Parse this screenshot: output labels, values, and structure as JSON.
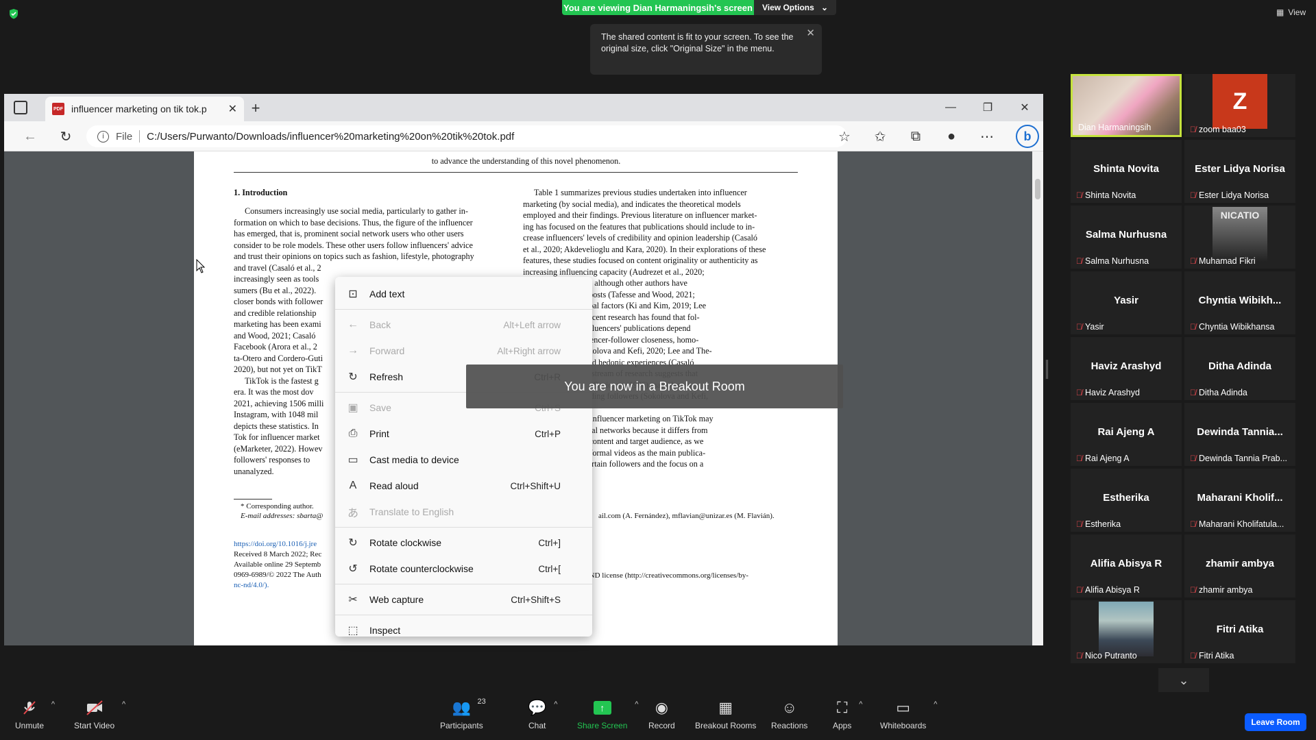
{
  "zoom_banner": {
    "viewing": "You are viewing Dian Harmaningsih's screen",
    "view_options": "View Options"
  },
  "tooltip": "The shared content is fit to your screen. To see the original size, click \"Original Size\" in the menu.",
  "top_right_view": "View",
  "browser": {
    "tab_title": "influencer marketing on tik tok.p",
    "address_prefix": "File",
    "url": "C:/Users/Purwanto/Downloads/influencer%20marketing%20on%20tik%20tok.pdf"
  },
  "pdf": {
    "header_line": "to advance the understanding of this novel phenomenon.",
    "intro_heading": "1.  Introduction",
    "left_col": [
      "Consumers increasingly use social media, particularly to gather in-",
      "formation on which to base decisions. Thus, the figure of the influencer",
      "has emerged, that is, prominent social network users who other users",
      "consider to be role models. These other users follow influencers' advice",
      "and trust their opinions on topics such as fashion, lifestyle, photography",
      "and travel (Casaló et al., 2",
      "increasingly seen as tools",
      "sumers (Bu et al., 2022).",
      "closer bonds with follower",
      "and credible relationship",
      "marketing has been exami",
      "and Wood, 2021; Casaló",
      "Facebook (Arora et al., 2",
      "ta-Otero and Cordero-Guti",
      "2020), but not yet on TikT",
      "TikTok is the fastest g",
      "era. It was the most dov",
      "2021, achieving 1506 milli",
      "Instagram, with 1048 mil",
      "depicts these statistics. In",
      "Tok for influencer market",
      "(eMarketer, 2022). Howev",
      "followers' responses to",
      "unanalyzed."
    ],
    "right_col": [
      "Table 1 summarizes previous studies undertaken into influencer",
      "marketing (by social media), and indicates the theoretical models",
      "employed and their findings. Previous literature on influencer market-",
      "ing has focused on the features that publications should include to in-",
      "crease influencers' levels of credibility and opinion leadership (Casaló",
      "et al., 2020; Akdevelioglu and Kara, 2020). In their explorations of these",
      "features, these studies focused on content originality or authenticity as",
      "increasing influencing capacity (Audrezet et al., 2020;",
      "20; Lee et al., 2022), although other authors have",
      "ntity and quality of posts (Tafesse and Wood, 2021;",
      ") and visual and verbal factors (Ki and Kim, 2019; Lee",
      "21). Nevertheless, recent research has found that fol-",
      "responses toward influencers' publications depend",
      "factors such as influencer-follower closeness, homo-",
      "ional contagion (Sokolova and Kefi, 2020; Lee and The-",
      "positive emotions and hedonic experiences (Casaló",
      "and Ha, 2021). This stream of research suggests that",
      "... (ELM) (Petty and Cacioppo, 1986) may play an",
      "ortant role in persuading followers (Sokolova and Kefi,",
      "eokary, 2021).",
      "ers' responses to influencer marketing on TikTok may",
      "s made on other social networks because it differs from",
      "publication format, content and target audience, as we",
      ". The use of short informal videos as the main publica-",
      "use of humor to entertain followers and the focus on a"
    ],
    "footnote": [
      "* Corresponding author.",
      "E-mail addresses: sbarta@",
      "ail.com (A. Fernández), mflavian@unizar.es (M. Flavián)."
    ],
    "footer": [
      "https://doi.org/10.1016/j.jre",
      "Received 8 March 2022; Rec",
      "Available online 29 Septemb",
      "0969-6989/© 2022 The Auth",
      "BY-NC-ND license (http://creativecommons.org/licenses/by-",
      "nc-nd/4.0/)."
    ]
  },
  "context_menu": [
    {
      "label": "Add text",
      "shortcut": "",
      "icon": "add-text-icon",
      "enabled": true
    },
    {
      "label": "Back",
      "shortcut": "Alt+Left arrow",
      "icon": "back-arrow-icon",
      "enabled": false
    },
    {
      "label": "Forward",
      "shortcut": "Alt+Right arrow",
      "icon": "forward-arrow-icon",
      "enabled": false
    },
    {
      "label": "Refresh",
      "shortcut": "Ctrl+R",
      "icon": "refresh-icon",
      "enabled": true
    },
    {
      "label": "Save",
      "shortcut": "Ctrl+S",
      "icon": "save-icon",
      "enabled": false
    },
    {
      "label": "Print",
      "shortcut": "Ctrl+P",
      "icon": "print-icon",
      "enabled": true
    },
    {
      "label": "Cast media to device",
      "shortcut": "",
      "icon": "cast-icon",
      "enabled": true
    },
    {
      "label": "Read aloud",
      "shortcut": "Ctrl+Shift+U",
      "icon": "read-aloud-icon",
      "enabled": true
    },
    {
      "label": "Translate to English",
      "shortcut": "",
      "icon": "translate-icon",
      "enabled": false
    },
    {
      "label": "Rotate clockwise",
      "shortcut": "Ctrl+]",
      "icon": "rotate-clockwise-icon",
      "enabled": true
    },
    {
      "label": "Rotate counterclockwise",
      "shortcut": "Ctrl+[",
      "icon": "rotate-counterclockwise-icon",
      "enabled": true
    },
    {
      "label": "Web capture",
      "shortcut": "Ctrl+Shift+S",
      "icon": "web-capture-icon",
      "enabled": true
    },
    {
      "label": "Inspect",
      "shortcut": "",
      "icon": "inspect-icon",
      "enabled": true
    }
  ],
  "breakout_notice": "You are now in a Breakout Room",
  "participants": [
    {
      "name": "Dian Harmaningsih",
      "big": ""
    },
    {
      "name": "zoom baa03",
      "big": "Z"
    },
    {
      "name": "Shinta Novita",
      "big": "Shinta Novita"
    },
    {
      "name": "Ester Lidya Norisa",
      "big": "Ester Lidya Norisa"
    },
    {
      "name": "Salma Nurhusna",
      "big": "Salma Nurhusna"
    },
    {
      "name": "Muhamad Fikri",
      "big": "NICATIO"
    },
    {
      "name": "Yasir",
      "big": "Yasir"
    },
    {
      "name": "Chyntia Wibikhansa",
      "big": "Chyntia  Wibikh..."
    },
    {
      "name": "Haviz Arashyd",
      "big": "Haviz Arashyd"
    },
    {
      "name": "Ditha Adinda",
      "big": "Ditha Adinda"
    },
    {
      "name": "Rai Ajeng A",
      "big": "Rai Ajeng A"
    },
    {
      "name": "Dewinda Tannia Prab...",
      "big": "Dewinda  Tannia..."
    },
    {
      "name": "Estherika",
      "big": "Estherika"
    },
    {
      "name": "Maharani Kholifatula...",
      "big": "Maharani  Kholif..."
    },
    {
      "name": "Alifia Abisya R",
      "big": "Alifia Abisya R"
    },
    {
      "name": "zhamir ambya",
      "big": "zhamir ambya"
    },
    {
      "name": "Nico Putranto",
      "big": ""
    },
    {
      "name": "Fitri Atika",
      "big": "Fitri Atika"
    }
  ],
  "toolbar": {
    "unmute": "Unmute",
    "start_video": "Start Video",
    "participants": "Participants",
    "participants_count": "23",
    "chat": "Chat",
    "share_screen": "Share Screen",
    "record": "Record",
    "breakout_rooms": "Breakout Rooms",
    "reactions": "Reactions",
    "apps": "Apps",
    "whiteboards": "Whiteboards",
    "leave": "Leave Room"
  },
  "colors": {
    "share_green": "#23c552",
    "leave_blue": "#0b5cff",
    "speaker_border": "#c5e33d",
    "link_blue": "#1a5fb4"
  }
}
